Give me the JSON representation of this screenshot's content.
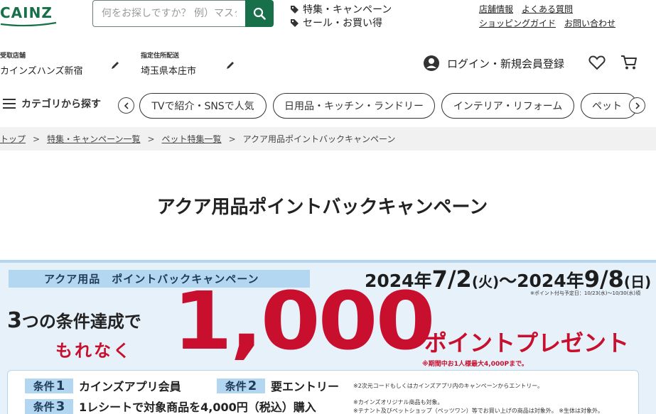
{
  "header": {
    "logo_text": "CAINZ",
    "search": {
      "placeholder": "何をお探しですか？ 例）マスク"
    },
    "promo_links": [
      "特集・キャンペーン",
      "セール・お買い得"
    ],
    "util_links": [
      "店舗情報",
      "よくある質問",
      "ショッピングガイド",
      "お問い合わせ"
    ],
    "store": {
      "label": "受取店舗",
      "value": "カインズハンズ新宿"
    },
    "delivery": {
      "label": "指定住所配送",
      "value": "埼玉県本庄市"
    },
    "login_label": "ログイン・新規会員登録"
  },
  "category_bar": {
    "menu_label": "カテゴリから探す",
    "pills": [
      "TVで紹介・SNSで人気",
      "日用品・キッチン・ランドリー",
      "インテリア・リフォーム",
      "ペット"
    ]
  },
  "breadcrumb": [
    "トップ",
    "特集・キャンペーン一覧",
    "ペット特集一覧",
    "アクア用品ポイントバックキャンペーン"
  ],
  "page_title": "アクア用品ポイントバックキャンペーン",
  "banner": {
    "label": "アクア用品　ポイントバックキャンペーン",
    "date_year1": "2024年",
    "date_md1": "7/2",
    "date_dow1": "(火)",
    "date_tilde": "〜",
    "date_year2": "2024年",
    "date_md2": "9/8",
    "date_dow2": "(日)",
    "date_note": "※ポイント付与予定日：10/23(水)〜10/30(水)頃",
    "conditions_lead_1": "3",
    "conditions_lead_2": "つの条件達成で",
    "free_text": "もれなく",
    "point_amount": "1,000",
    "points_label": "ポイントプレゼント",
    "points_note": "※期間中お1人様最大4,000Pまで。",
    "conditions": [
      {
        "tag": "条件",
        "num": "1",
        "text": "カインズアプリ会員"
      },
      {
        "tag": "条件",
        "num": "2",
        "text": "要エントリー"
      },
      {
        "tag": "条件",
        "num": "3",
        "text": "1レシートで対象商品を4,000円（税込）購入"
      }
    ],
    "notes": [
      "※2次元コードもしくはカインズアプリ内のキャンペーンからエントリー。",
      "※カインズオリジナル商品も対象。",
      "※テナント及びペットショップ（ペッツワン）等でお買い上げの商品は対象外。 ※生体は対象外。"
    ]
  },
  "colors": {
    "brand_green": "#17704a",
    "accent_red": "#c8102e",
    "banner_blue": "#b3d6f1"
  }
}
